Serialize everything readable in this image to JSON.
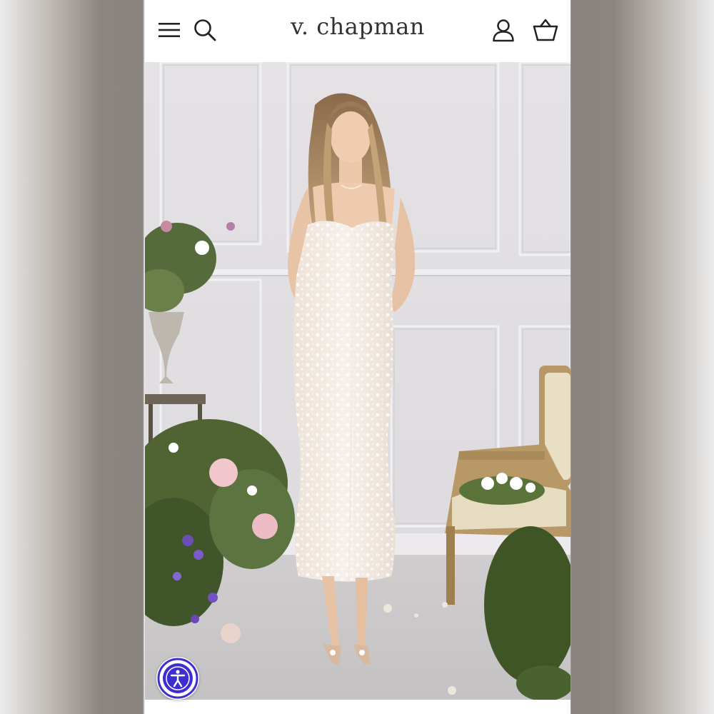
{
  "header": {
    "brand": "v. chapman",
    "menu_icon": "hamburger-menu-icon",
    "search_icon": "search-icon",
    "account_icon": "user-account-icon",
    "cart_icon": "shopping-basket-icon"
  },
  "hero": {
    "image_kind": "product photo",
    "background_color": "#e6e4e6",
    "dress_color": "#f3ebe4"
  },
  "accessibility": {
    "icon": "accessibility-icon",
    "accent_color": "#3f2ecf"
  }
}
